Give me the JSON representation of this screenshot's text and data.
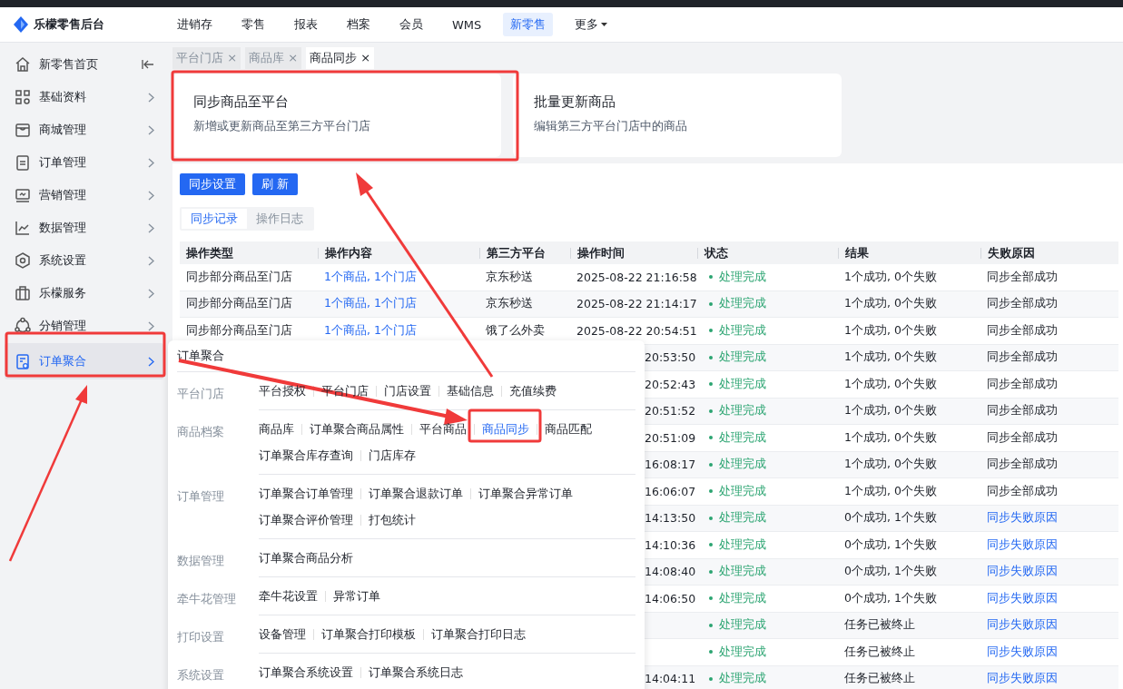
{
  "app": {
    "title": "乐檬零售后台"
  },
  "nav": [
    {
      "label": "进销存",
      "selected": false
    },
    {
      "label": "零售",
      "selected": false
    },
    {
      "label": "报表",
      "selected": false
    },
    {
      "label": "档案",
      "selected": false
    },
    {
      "label": "会员",
      "selected": false
    },
    {
      "label": "WMS",
      "selected": false
    },
    {
      "label": "新零售",
      "selected": true
    },
    {
      "label": "更多",
      "selected": false,
      "dropdown": true
    }
  ],
  "sidebar": {
    "items": [
      {
        "label": "新零售首页",
        "collapse": true,
        "selected": false
      },
      {
        "label": "基础资料",
        "selected": false
      },
      {
        "label": "商城管理",
        "selected": false
      },
      {
        "label": "订单管理",
        "selected": false
      },
      {
        "label": "营销管理",
        "selected": false
      },
      {
        "label": "数据管理",
        "selected": false
      },
      {
        "label": "系统设置",
        "selected": false
      },
      {
        "label": "乐檬服务",
        "selected": false
      },
      {
        "label": "分销管理",
        "selected": false
      },
      {
        "label": "订单聚合",
        "selected": true
      }
    ]
  },
  "page_tabs": [
    {
      "label": "平台门店",
      "close": "×",
      "selected": false
    },
    {
      "label": "商品库",
      "close": "×",
      "selected": false
    },
    {
      "label": "商品同步",
      "close": "×",
      "selected": true
    }
  ],
  "cards": [
    {
      "title": "同步商品至平台",
      "description": "新增或更新商品至第三方平台门店"
    },
    {
      "title": "批量更新商品",
      "description": "编辑第三方平台门店中的商品"
    }
  ],
  "buttons": [
    "同步设置",
    "刷 新"
  ],
  "sub_tabs": [
    {
      "label": "同步记录",
      "selected": true
    },
    {
      "label": "操作日志",
      "selected": false
    }
  ],
  "table": {
    "columns": [
      "操作类型",
      "操作内容",
      "第三方平台",
      "操作时间",
      "状态",
      "结果",
      "失败原因"
    ],
    "rows": [
      {
        "type": "同步部分商品至门店",
        "content": "1个商品, 1个门店",
        "platform": "京东秒送",
        "time": "2025-08-22 21:16:58",
        "status": "处理完成",
        "result": "1个成功, 0个失败",
        "reason": "同步全部成功",
        "reason_link": false
      },
      {
        "type": "同步部分商品至门店",
        "content": "1个商品, 1个门店",
        "platform": "京东秒送",
        "time": "2025-08-22 21:14:17",
        "status": "处理完成",
        "result": "1个成功, 0个失败",
        "reason": "同步全部成功",
        "reason_link": false
      },
      {
        "type": "同步部分商品至门店",
        "content": "1个商品, 1个门店",
        "platform": "饿了么外卖",
        "time": "2025-08-22 20:54:51",
        "status": "处理完成",
        "result": "1个成功, 0个失败",
        "reason": "同步全部成功",
        "reason_link": false
      },
      {
        "time": "20:53:50",
        "status": "处理完成",
        "result": "1个成功, 0个失败",
        "reason": "同步全部成功",
        "reason_link": false
      },
      {
        "time": "20:52:43",
        "status": "处理完成",
        "result": "1个成功, 0个失败",
        "reason": "同步全部成功",
        "reason_link": false
      },
      {
        "time": "20:51:52",
        "status": "处理完成",
        "result": "1个成功, 0个失败",
        "reason": "同步全部成功",
        "reason_link": false
      },
      {
        "time": "20:51:09",
        "status": "处理完成",
        "result": "1个成功, 0个失败",
        "reason": "同步全部成功",
        "reason_link": false
      },
      {
        "time": "16:08:17",
        "status": "处理完成",
        "result": "1个成功, 0个失败",
        "reason": "同步全部成功",
        "reason_link": false
      },
      {
        "time": "16:06:07",
        "status": "处理完成",
        "result": "1个成功, 0个失败",
        "reason": "同步全部成功",
        "reason_link": false
      },
      {
        "time": "14:13:50",
        "status": "处理完成",
        "result": "0个成功, 1个失败",
        "reason": "同步失败原因",
        "reason_link": true
      },
      {
        "time": "14:10:36",
        "status": "处理完成",
        "result": "0个成功, 1个失败",
        "reason": "同步失败原因",
        "reason_link": true
      },
      {
        "time": "14:08:40",
        "status": "处理完成",
        "result": "0个成功, 1个失败",
        "reason": "同步失败原因",
        "reason_link": true
      },
      {
        "time": "14:06:50",
        "status": "处理完成",
        "result": "0个成功, 1个失败",
        "reason": "同步失败原因",
        "reason_link": true
      },
      {
        "status": "处理完成",
        "result": "任务已被终止",
        "reason": "同步失败原因",
        "reason_link": true
      },
      {
        "status": "处理完成",
        "result": "任务已被终止",
        "reason": "同步失败原因",
        "reason_link": true
      },
      {
        "time": "14:04:11",
        "status": "处理完成",
        "result": "任务已被终止",
        "reason": "同步失败原因",
        "reason_link": true
      }
    ]
  },
  "menu": {
    "title": "订单聚合",
    "sections": [
      {
        "label": "平台门店",
        "lines": [
          [
            {
              "label": "平台授权",
              "selected": false
            },
            {
              "label": "平台门店",
              "selected": false
            },
            {
              "label": "门店设置",
              "selected": false
            },
            {
              "label": "基础信息",
              "selected": false
            },
            {
              "label": "充值续费",
              "selected": false
            }
          ]
        ]
      },
      {
        "label": "商品档案",
        "lines": [
          [
            {
              "label": "商品库",
              "selected": false
            },
            {
              "label": "订单聚合商品属性",
              "selected": false
            },
            {
              "label": "平台商品",
              "selected": false
            },
            {
              "label": "商品同步",
              "selected": true
            },
            {
              "label": "商品匹配",
              "selected": false
            }
          ],
          [
            {
              "label": "订单聚合库存查询",
              "selected": false
            },
            {
              "label": "门店库存",
              "selected": false
            }
          ]
        ]
      },
      {
        "label": "订单管理",
        "lines": [
          [
            {
              "label": "订单聚合订单管理",
              "selected": false
            },
            {
              "label": "订单聚合退款订单",
              "selected": false
            },
            {
              "label": "订单聚合异常订单",
              "selected": false
            }
          ],
          [
            {
              "label": "订单聚合评价管理",
              "selected": false
            },
            {
              "label": "打包统计",
              "selected": false
            }
          ]
        ]
      },
      {
        "label": "数据管理",
        "lines": [
          [
            {
              "label": "订单聚合商品分析",
              "selected": false
            }
          ]
        ]
      },
      {
        "label": "牵牛花管理",
        "lines": [
          [
            {
              "label": "牵牛花设置",
              "selected": false
            },
            {
              "label": "异常订单",
              "selected": false
            }
          ]
        ]
      },
      {
        "label": "打印设置",
        "lines": [
          [
            {
              "label": "设备管理",
              "selected": false
            },
            {
              "label": "订单聚合打印模板",
              "selected": false
            },
            {
              "label": "订单聚合打印日志",
              "selected": false
            }
          ]
        ]
      },
      {
        "label": "系统设置",
        "lines": [
          [
            {
              "label": "订单聚合系统设置",
              "selected": false
            },
            {
              "label": "订单聚合系统日志",
              "selected": false
            }
          ]
        ]
      }
    ]
  }
}
